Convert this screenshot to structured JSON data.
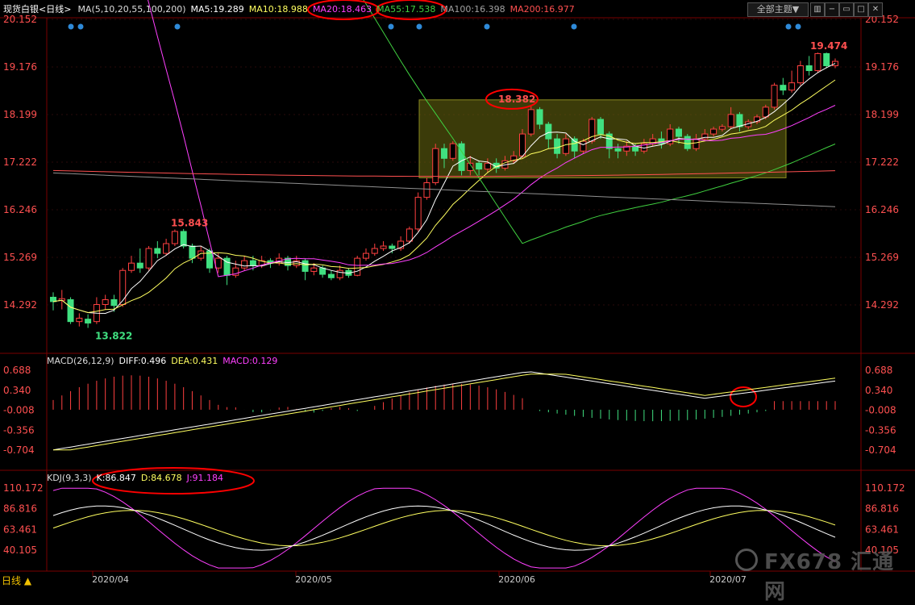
{
  "header": {
    "title": "现货白银<日线>",
    "ma_params": "MA(5,10,20,55,100,200)",
    "ma5": "MA5:19.289",
    "ma10": "MA10:18.988",
    "ma20": "MA20:18.463",
    "ma55": "MA55:17.538",
    "ma100": "MA100:16.398",
    "ma200": "MA200:16.977",
    "theme_button": "全部主题▼"
  },
  "colors": {
    "up": "#ff4040",
    "down": "#40e080",
    "ma5": "#ffffff",
    "ma10": "#ffff60",
    "ma20": "#ff40ff",
    "ma55": "#40d040",
    "ma100": "#909090",
    "ma200": "#ff5050",
    "annotation": "#ff0000",
    "box": "#6b6b10"
  },
  "price_axis": [
    "20.152",
    "19.176",
    "18.199",
    "17.222",
    "16.246",
    "15.269",
    "14.292"
  ],
  "annotations": {
    "high1": "15.843",
    "low1": "13.822",
    "high2": "18.382",
    "high3": "19.474"
  },
  "macd": {
    "title": "MACD(26,12,9)",
    "diff": "DIFF:0.496",
    "dea": "DEA:0.431",
    "macd": "MACD:0.129",
    "axis": [
      "0.688",
      "0.340",
      "-0.008",
      "-0.356",
      "-0.704"
    ]
  },
  "kdj": {
    "title": "KDJ(9,3,3)",
    "k": "K:86.847",
    "d": "D:84.678",
    "j": "J:91.184",
    "axis": [
      "110.172",
      "86.816",
      "63.461",
      "40.105"
    ]
  },
  "x_axis": [
    "2020/04",
    "2020/05",
    "2020/06",
    "2020/07"
  ],
  "bottom_tab": "日线 ▲",
  "watermark": "FX678 汇通网",
  "chart_data": {
    "type": "candlestick",
    "ylim": [
      13.7,
      20.3
    ],
    "candles": [
      [
        14.45,
        14.36,
        14.55,
        14.18
      ],
      [
        14.38,
        14.42,
        14.6,
        14.2
      ],
      [
        14.4,
        13.95,
        14.45,
        13.9
      ],
      [
        13.95,
        14.02,
        14.12,
        13.85
      ],
      [
        14.0,
        13.92,
        14.1,
        13.82
      ],
      [
        13.95,
        14.3,
        14.45,
        13.9
      ],
      [
        14.3,
        14.4,
        14.5,
        14.2
      ],
      [
        14.4,
        14.28,
        14.5,
        14.15
      ],
      [
        14.3,
        15.0,
        15.05,
        14.25
      ],
      [
        15.0,
        15.15,
        15.3,
        14.95
      ],
      [
        15.15,
        15.05,
        15.45,
        14.95
      ],
      [
        15.05,
        15.45,
        15.5,
        15.0
      ],
      [
        15.45,
        15.35,
        15.6,
        15.25
      ],
      [
        15.35,
        15.55,
        15.65,
        15.3
      ],
      [
        15.55,
        15.8,
        15.84,
        15.5
      ],
      [
        15.8,
        15.5,
        15.85,
        15.45
      ],
      [
        15.5,
        15.25,
        15.55,
        15.15
      ],
      [
        15.25,
        15.4,
        15.5,
        15.2
      ],
      [
        15.4,
        15.05,
        15.45,
        14.95
      ],
      [
        15.05,
        15.25,
        15.35,
        14.95
      ],
      [
        15.25,
        14.9,
        15.3,
        14.7
      ],
      [
        14.9,
        15.05,
        15.2,
        14.85
      ],
      [
        15.05,
        15.2,
        15.3,
        15.0
      ],
      [
        15.2,
        15.1,
        15.3,
        15.0
      ],
      [
        15.1,
        15.2,
        15.3,
        15.05
      ],
      [
        15.2,
        15.15,
        15.25,
        15.05
      ],
      [
        15.15,
        15.25,
        15.35,
        15.1
      ],
      [
        15.25,
        15.1,
        15.3,
        15.0
      ],
      [
        15.1,
        15.2,
        15.3,
        15.05
      ],
      [
        15.2,
        14.98,
        15.25,
        14.8
      ],
      [
        14.98,
        15.05,
        15.15,
        14.9
      ],
      [
        15.05,
        14.92,
        15.1,
        14.85
      ],
      [
        14.92,
        14.85,
        15.0,
        14.8
      ],
      [
        14.85,
        15.0,
        15.1,
        14.8
      ],
      [
        15.0,
        14.9,
        15.05,
        14.85
      ],
      [
        14.9,
        15.25,
        15.3,
        14.88
      ],
      [
        15.25,
        15.35,
        15.45,
        15.2
      ],
      [
        15.35,
        15.45,
        15.55,
        15.3
      ],
      [
        15.45,
        15.5,
        15.6,
        15.4
      ],
      [
        15.5,
        15.45,
        15.55,
        15.35
      ],
      [
        15.45,
        15.6,
        15.7,
        15.4
      ],
      [
        15.6,
        15.85,
        15.9,
        15.55
      ],
      [
        15.85,
        16.5,
        16.6,
        15.8
      ],
      [
        16.5,
        16.8,
        16.9,
        16.45
      ],
      [
        16.8,
        17.5,
        17.6,
        16.75
      ],
      [
        17.5,
        17.3,
        17.6,
        17.1
      ],
      [
        17.3,
        17.6,
        17.65,
        17.25
      ],
      [
        17.6,
        17.05,
        17.65,
        16.95
      ],
      [
        17.05,
        17.2,
        17.35,
        16.95
      ],
      [
        17.2,
        17.08,
        17.25,
        16.95
      ],
      [
        17.08,
        17.2,
        17.3,
        17.0
      ],
      [
        17.2,
        17.1,
        17.3,
        17.0
      ],
      [
        17.1,
        17.25,
        17.35,
        17.05
      ],
      [
        17.25,
        17.35,
        17.45,
        17.2
      ],
      [
        17.35,
        17.8,
        17.9,
        17.3
      ],
      [
        17.8,
        18.3,
        18.38,
        17.75
      ],
      [
        18.3,
        18.0,
        18.35,
        17.9
      ],
      [
        18.0,
        17.7,
        18.05,
        17.5
      ],
      [
        17.7,
        17.4,
        17.8,
        17.3
      ],
      [
        17.4,
        17.7,
        17.8,
        17.35
      ],
      [
        17.7,
        17.45,
        17.75,
        17.3
      ],
      [
        17.45,
        17.65,
        17.7,
        17.4
      ],
      [
        17.65,
        18.1,
        18.15,
        17.6
      ],
      [
        18.1,
        17.8,
        18.15,
        17.7
      ],
      [
        17.8,
        17.5,
        17.85,
        17.3
      ],
      [
        17.5,
        17.45,
        17.6,
        17.3
      ],
      [
        17.45,
        17.55,
        17.65,
        17.35
      ],
      [
        17.55,
        17.45,
        17.6,
        17.35
      ],
      [
        17.45,
        17.6,
        17.7,
        17.4
      ],
      [
        17.6,
        17.7,
        17.8,
        17.55
      ],
      [
        17.7,
        17.6,
        17.85,
        17.5
      ],
      [
        17.6,
        17.9,
        18.0,
        17.55
      ],
      [
        17.9,
        17.75,
        17.95,
        17.6
      ],
      [
        17.75,
        17.5,
        17.8,
        17.45
      ],
      [
        17.5,
        17.7,
        17.8,
        17.45
      ],
      [
        17.7,
        17.8,
        17.9,
        17.65
      ],
      [
        17.8,
        17.9,
        17.95,
        17.75
      ],
      [
        17.9,
        17.95,
        18.0,
        17.85
      ],
      [
        17.95,
        18.2,
        18.35,
        17.9
      ],
      [
        18.2,
        17.95,
        18.25,
        17.85
      ],
      [
        17.95,
        18.05,
        18.1,
        17.9
      ],
      [
        18.05,
        18.15,
        18.2,
        18.0
      ],
      [
        18.15,
        18.35,
        18.4,
        18.1
      ],
      [
        18.35,
        18.8,
        18.85,
        18.3
      ],
      [
        18.8,
        18.7,
        18.95,
        18.6
      ],
      [
        18.7,
        18.85,
        19.1,
        18.65
      ],
      [
        18.85,
        19.2,
        19.3,
        18.8
      ],
      [
        19.2,
        19.1,
        19.4,
        19.0
      ],
      [
        19.1,
        19.45,
        19.47,
        19.05
      ],
      [
        19.45,
        19.2,
        19.47,
        19.15
      ],
      [
        19.2,
        19.29,
        19.35,
        19.15
      ]
    ]
  }
}
